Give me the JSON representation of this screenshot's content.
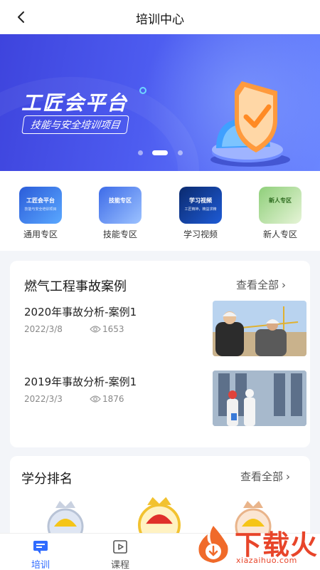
{
  "header": {
    "title": "培训中心",
    "back_icon": "chevron-left-icon"
  },
  "banner": {
    "title": "工匠会平台",
    "subtitle": "技能与安全培训项目",
    "active_slide": 2,
    "slide_count": 3
  },
  "categories": [
    {
      "label": "通用专区",
      "tile_text": "工匠会平台",
      "tile_sub": "技能与安全培训项目",
      "color_from": "#2b5cd9",
      "color_to": "#5aa8ff"
    },
    {
      "label": "技能专区",
      "tile_text": "技能专区",
      "tile_sub": "",
      "color_from": "#3d6be8",
      "color_to": "#9cc2ff"
    },
    {
      "label": "学习视频",
      "tile_text": "学习视频",
      "tile_sub": "工匠精神，精益求精",
      "color_from": "#0b2a6e",
      "color_to": "#1e5bd6"
    },
    {
      "label": "新人专区",
      "tile_text": "新人专区",
      "tile_sub": "",
      "color_from": "#8fcf7a",
      "color_to": "#e6f4d7"
    }
  ],
  "cases_section": {
    "title": "燃气工程事故案例",
    "view_all": "查看全部",
    "items": [
      {
        "title": "2020年事故分析-案例1",
        "date": "2022/3/8",
        "views": "1653"
      },
      {
        "title": "2019年事故分析-案例1",
        "date": "2022/3/3",
        "views": "1876"
      }
    ]
  },
  "ranking_section": {
    "title": "学分排名",
    "view_all": "查看全部"
  },
  "tabbar": {
    "tabs": [
      {
        "label": "培训",
        "active": true
      },
      {
        "label": "课程",
        "active": false
      }
    ]
  },
  "watermark": {
    "brand": "下载火",
    "url": "xiazaihuo.com"
  },
  "colors": {
    "accent": "#2f6bff",
    "banner": "#4d5cf0",
    "watermark": "#e8452a"
  }
}
